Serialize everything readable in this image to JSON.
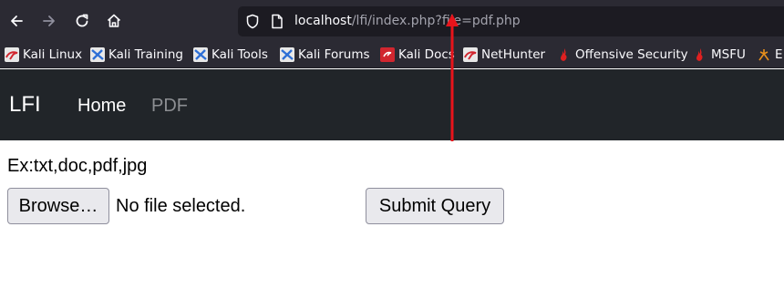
{
  "browser": {
    "url_host": "localhost",
    "url_rest": "/lfi/index.php?file=pdf.php",
    "toolbar_icons": [
      "back-arrow-icon",
      "forward-arrow-icon",
      "reload-icon",
      "home-icon",
      "shield-icon",
      "page-icon"
    ]
  },
  "bookmarks": [
    {
      "label": "Kali Linux",
      "icon": "kali-linux-icon"
    },
    {
      "label": "Kali Training",
      "icon": "kali-training-icon"
    },
    {
      "label": "Kali Tools",
      "icon": "kali-tools-icon"
    },
    {
      "label": "Kali Forums",
      "icon": "kali-forums-icon"
    },
    {
      "label": "Kali Docs",
      "icon": "kali-docs-icon"
    },
    {
      "label": "NetHunter",
      "icon": "nethunter-icon"
    },
    {
      "label": "Offensive Security",
      "icon": "offensive-security-icon"
    },
    {
      "label": "MSFU",
      "icon": "msfu-icon"
    },
    {
      "label": "E",
      "icon": "exploit-db-icon"
    }
  ],
  "navbar": {
    "brand": "LFI",
    "links": [
      {
        "label": "Home",
        "active": true
      },
      {
        "label": "PDF",
        "active": false
      }
    ]
  },
  "content": {
    "hint": "Ex:txt,doc,pdf,jpg",
    "browse_label": "Browse…",
    "file_status": "No file selected.",
    "submit_label": "Submit Query"
  },
  "colors": {
    "browser_chrome": "#2b2a33",
    "urlbar": "#1c1b22",
    "navbar": "#212529",
    "annotation_arrow": "#e8141b"
  }
}
